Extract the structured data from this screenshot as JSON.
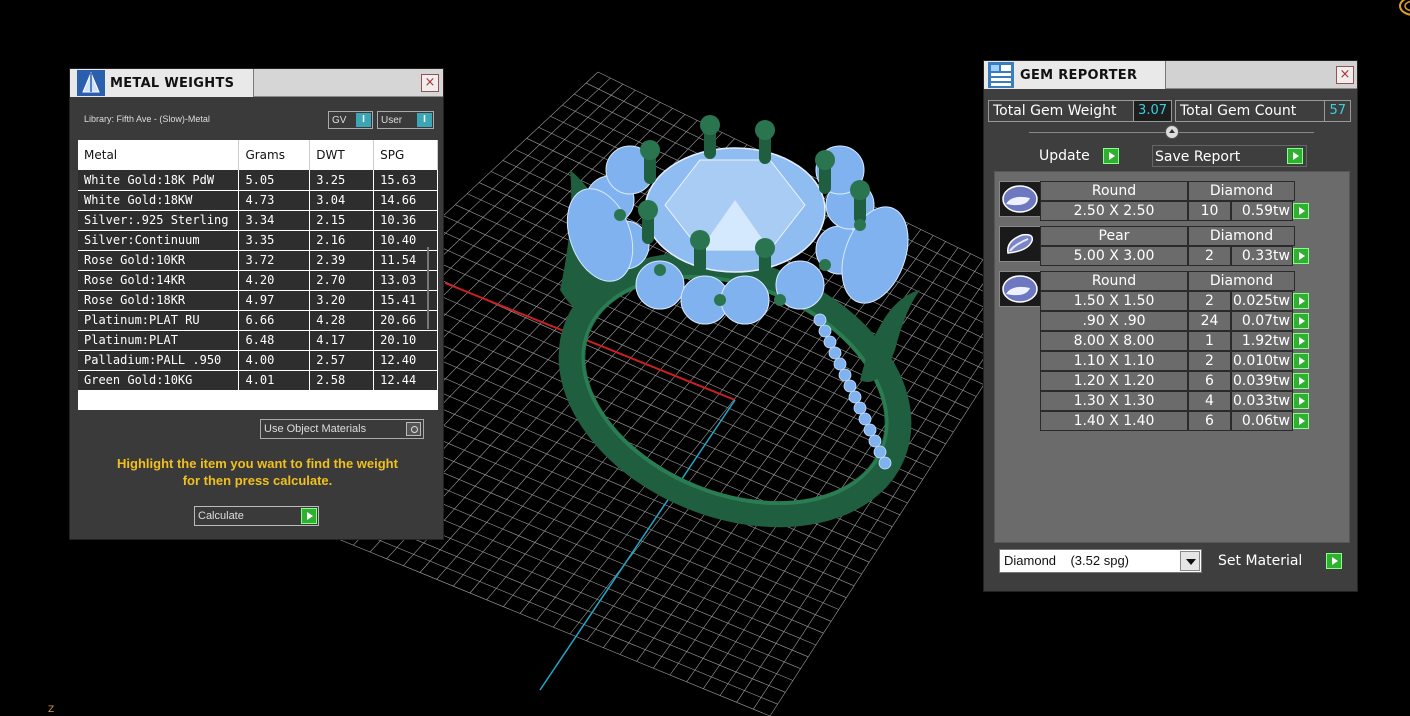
{
  "viewport": {
    "axis_label": "Z",
    "colors": {
      "grid": "#d0d0d0",
      "x_axis": "#cc2020",
      "y_axis": "#20a8c8",
      "ring_metal": "#1f5e3e",
      "gems": "#7fb2ee"
    }
  },
  "metal_weights": {
    "title": "METAL WEIGHTS",
    "close_icon": "close-icon",
    "library_label": "Library: Fifth Ave - (Slow)-Metal",
    "toggle_gv": "GV",
    "toggle_user": "User",
    "toggle_btn": "I",
    "columns": [
      "Metal",
      "Grams",
      "DWT",
      "SPG"
    ],
    "rows": [
      [
        "White Gold:18K PdW",
        "5.05",
        "3.25",
        "15.63"
      ],
      [
        "White Gold:18KW",
        "4.73",
        "3.04",
        "14.66"
      ],
      [
        "Silver:.925 Sterling",
        "3.34",
        "2.15",
        "10.36"
      ],
      [
        "Silver:Continuum",
        "3.35",
        "2.16",
        "10.40"
      ],
      [
        "Rose Gold:10KR",
        "3.72",
        "2.39",
        "11.54"
      ],
      [
        "Rose Gold:14KR",
        "4.20",
        "2.70",
        "13.03"
      ],
      [
        "Rose Gold:18KR",
        "4.97",
        "3.20",
        "15.41"
      ],
      [
        "Platinum:PLAT RU",
        "6.66",
        "4.28",
        "20.66"
      ],
      [
        "Platinum:PLAT",
        "6.48",
        "4.17",
        "20.10"
      ],
      [
        "Palladium:PALL .950",
        "4.00",
        "2.57",
        "12.40"
      ],
      [
        "Green Gold:10KG",
        "4.01",
        "2.58",
        "12.44"
      ]
    ],
    "use_object_materials": "Use Object Materials",
    "hint_line1": "Highlight the item you want to find the weight",
    "hint_line2": "for then press calculate.",
    "calculate_label": "Calculate"
  },
  "gem_reporter": {
    "title": "GEM REPORTER",
    "total_weight_label": "Total Gem Weight",
    "total_weight_value": "3.07",
    "total_count_label": "Total Gem Count",
    "total_count_value": "57",
    "update_label": "Update",
    "save_report_label": "Save Report",
    "groups": [
      {
        "shape": "Round",
        "material": "Diamond",
        "rows": [
          {
            "size": "2.50 X 2.50",
            "count": "10",
            "weight": "0.59tw"
          }
        ]
      },
      {
        "shape": "Pear",
        "material": "Diamond",
        "rows": [
          {
            "size": "5.00 X 3.00",
            "count": "2",
            "weight": "0.33tw"
          }
        ]
      },
      {
        "shape": "Round",
        "material": "Diamond",
        "rows": [
          {
            "size": "1.50 X 1.50",
            "count": "2",
            "weight": "0.025tw"
          },
          {
            "size": ".90 X .90",
            "count": "24",
            "weight": "0.07tw"
          },
          {
            "size": "8.00 X 8.00",
            "count": "1",
            "weight": "1.92tw"
          },
          {
            "size": "1.10 X 1.10",
            "count": "2",
            "weight": "0.010tw"
          },
          {
            "size": "1.20 X 1.20",
            "count": "6",
            "weight": "0.039tw"
          },
          {
            "size": "1.30 X 1.30",
            "count": "4",
            "weight": "0.033tw"
          },
          {
            "size": "1.40 X 1.40",
            "count": "6",
            "weight": "0.06tw"
          }
        ]
      }
    ],
    "material_dropdown": "Diamond    (3.52 spg)",
    "set_material_label": "Set Material"
  }
}
